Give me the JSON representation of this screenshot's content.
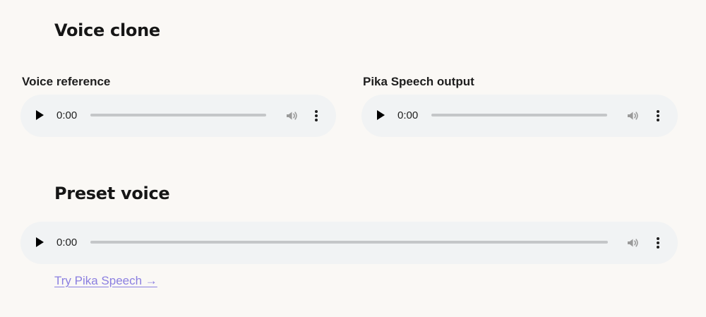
{
  "voice_clone": {
    "title": "Voice clone",
    "reference": {
      "label": "Voice reference",
      "time": "0:00",
      "progress": 0
    },
    "output": {
      "label": "Pika Speech output",
      "time": "0:00",
      "progress": 0
    }
  },
  "preset_voice": {
    "title": "Preset voice",
    "player": {
      "time": "0:00",
      "progress": 0
    }
  },
  "cta": {
    "link_text": "Try Pika Speech →"
  },
  "icons": {
    "play": "play-icon",
    "volume": "volume-icon",
    "more": "more-options-icon"
  },
  "colors": {
    "background": "#faf8f5",
    "player_background": "#f1f3f4",
    "link": "#8b7fe0"
  }
}
